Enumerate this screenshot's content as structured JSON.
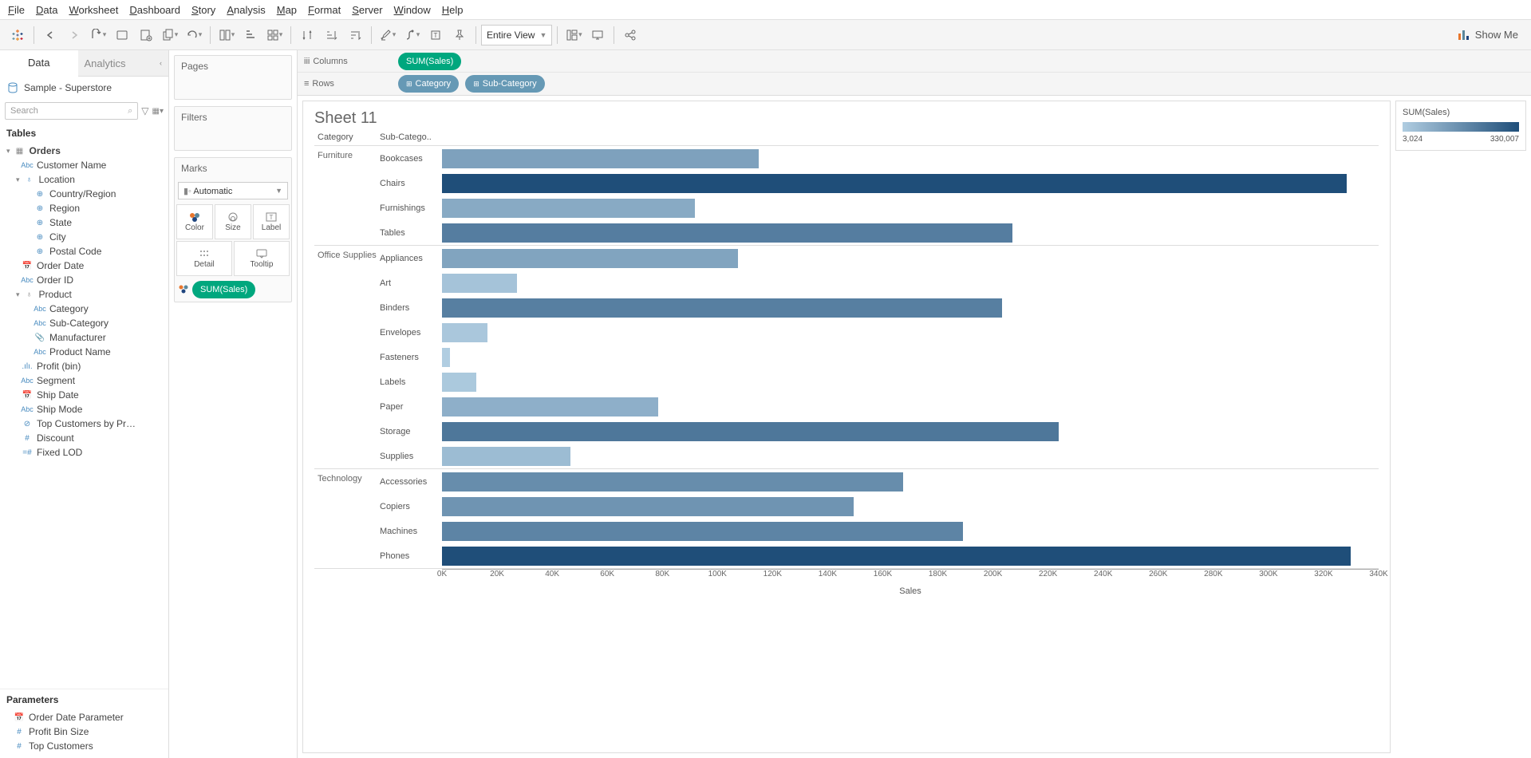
{
  "menubar": [
    "File",
    "Data",
    "Worksheet",
    "Dashboard",
    "Story",
    "Analysis",
    "Map",
    "Format",
    "Server",
    "Window",
    "Help"
  ],
  "toolbar": {
    "fit": "Entire View",
    "showme": "Show Me"
  },
  "sidebar": {
    "tab_data": "Data",
    "tab_analytics": "Analytics",
    "datasource": "Sample - Superstore",
    "search_placeholder": "Search",
    "tables_hdr": "Tables",
    "orders": "Orders",
    "fields": {
      "customer_name": "Customer Name",
      "location": "Location",
      "country": "Country/Region",
      "region": "Region",
      "state": "State",
      "city": "City",
      "postal": "Postal Code",
      "order_date": "Order Date",
      "order_id": "Order ID",
      "product": "Product",
      "category": "Category",
      "sub_category": "Sub-Category",
      "manufacturer": "Manufacturer",
      "product_name": "Product Name",
      "profit_bin": "Profit (bin)",
      "segment": "Segment",
      "ship_date": "Ship Date",
      "ship_mode": "Ship Mode",
      "top_cust": "Top Customers by Pr…",
      "discount": "Discount",
      "fixed_lod": "Fixed LOD"
    },
    "params_hdr": "Parameters",
    "params": {
      "odp": "Order Date Parameter",
      "pbs": "Profit Bin Size",
      "tc": "Top Customers"
    }
  },
  "shelves": {
    "pages": "Pages",
    "filters": "Filters",
    "marks": "Marks",
    "auto": "Automatic",
    "color": "Color",
    "size": "Size",
    "label": "Label",
    "detail": "Detail",
    "tooltip": "Tooltip",
    "sum_sales": "SUM(Sales)",
    "columns": "Columns",
    "rows": "Rows",
    "category": "Category",
    "sub_category": "Sub-Category"
  },
  "viz": {
    "title": "Sheet 11",
    "cat_hdr": "Category",
    "sub_hdr": "Sub-Catego..",
    "axis_label": "Sales",
    "legend_title": "SUM(Sales)",
    "legend_min": "3,024",
    "legend_max": "330,007"
  },
  "chart_data": {
    "type": "bar",
    "xlabel": "Sales",
    "ylabel": "",
    "xlim": [
      0,
      340000
    ],
    "x_ticks": [
      "0K",
      "20K",
      "40K",
      "60K",
      "80K",
      "100K",
      "120K",
      "140K",
      "160K",
      "180K",
      "200K",
      "220K",
      "240K",
      "260K",
      "280K",
      "300K",
      "320K",
      "340K"
    ],
    "color_scale": {
      "min": 3024,
      "max": 330007,
      "low_color": "#b0cde1",
      "high_color": "#1f4e79"
    },
    "groups": [
      {
        "category": "Furniture",
        "rows": [
          {
            "sub": "Bookcases",
            "value": 114880
          },
          {
            "sub": "Chairs",
            "value": 328449
          },
          {
            "sub": "Furnishings",
            "value": 91705
          },
          {
            "sub": "Tables",
            "value": 206966
          }
        ]
      },
      {
        "category": "Office Supplies",
        "rows": [
          {
            "sub": "Appliances",
            "value": 107532
          },
          {
            "sub": "Art",
            "value": 27119
          },
          {
            "sub": "Binders",
            "value": 203413
          },
          {
            "sub": "Envelopes",
            "value": 16476
          },
          {
            "sub": "Fasteners",
            "value": 3024
          },
          {
            "sub": "Labels",
            "value": 12486
          },
          {
            "sub": "Paper",
            "value": 78479
          },
          {
            "sub": "Storage",
            "value": 223844
          },
          {
            "sub": "Supplies",
            "value": 46674
          }
        ]
      },
      {
        "category": "Technology",
        "rows": [
          {
            "sub": "Accessories",
            "value": 167380
          },
          {
            "sub": "Copiers",
            "value": 149528
          },
          {
            "sub": "Machines",
            "value": 189239
          },
          {
            "sub": "Phones",
            "value": 330007
          }
        ]
      }
    ]
  }
}
